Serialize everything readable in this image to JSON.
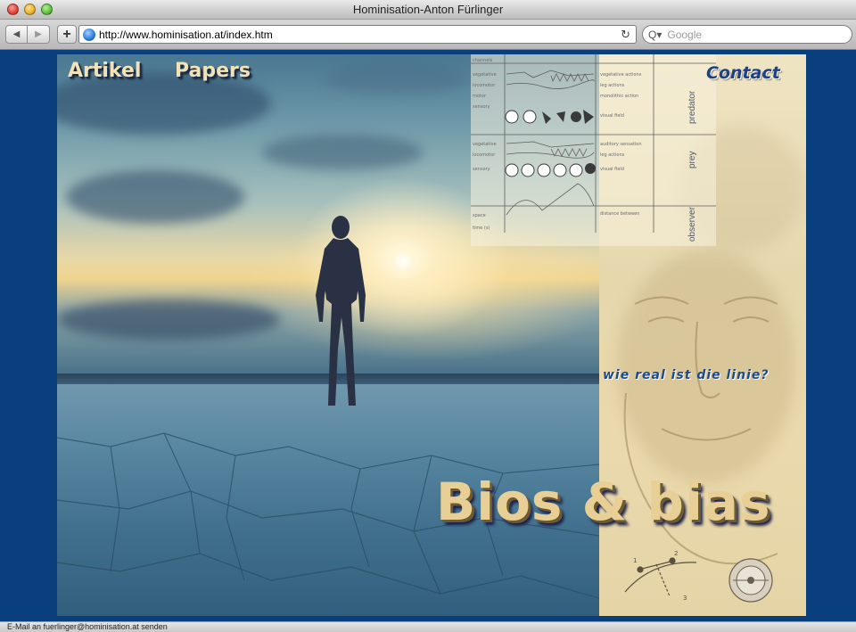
{
  "window": {
    "title": "Hominisation-Anton Fürlinger"
  },
  "toolbar": {
    "back_glyph": "◀",
    "forward_glyph": "▶",
    "add_glyph": "+",
    "url": "http://www.hominisation.at/index.htm",
    "reload_glyph": "↻",
    "search_glyph": "Q▾",
    "search_placeholder": "Google"
  },
  "nav": {
    "artikel": "Artikel",
    "papers": "Papers",
    "contact": "Contact"
  },
  "hero": {
    "tagline": "wie real ist die linie?",
    "headline": "Bios & bias"
  },
  "diagram": {
    "labels": [
      "predator",
      "prey",
      "observer"
    ]
  },
  "status": {
    "text": "E-Mail an fuerlinger@hominisation.at senden"
  },
  "colors": {
    "page_bg": "#0a3f7e",
    "headline": "#e7cf95",
    "tagline": "#1e4a8c"
  }
}
